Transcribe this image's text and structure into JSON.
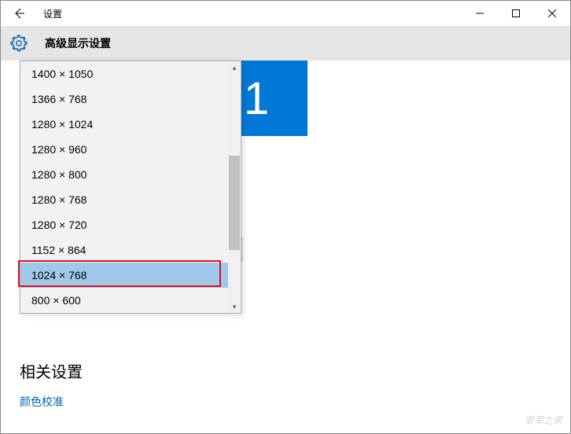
{
  "titlebar": {
    "title": "设置"
  },
  "header": {
    "page_title": "高级显示设置"
  },
  "monitor": {
    "number": "1"
  },
  "resolution_dropdown": {
    "options": [
      "1400 × 1050",
      "1366 × 768",
      "1280 × 1024",
      "1280 × 960",
      "1280 × 800",
      "1280 × 768",
      "1280 × 720",
      "1152 × 864",
      "1024 × 768",
      "800 × 600"
    ],
    "selected_index": 8
  },
  "related_settings": {
    "title": "相关设置",
    "link_color_calibration": "颜色校准"
  },
  "watermark": "翠翠之家"
}
